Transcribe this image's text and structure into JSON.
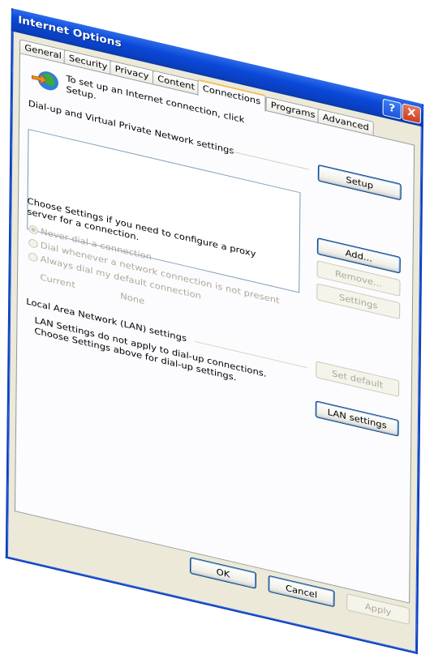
{
  "window": {
    "title": "Internet Options",
    "help_glyph": "?",
    "close_glyph": "X"
  },
  "tabs": [
    {
      "label": "General"
    },
    {
      "label": "Security"
    },
    {
      "label": "Privacy"
    },
    {
      "label": "Content"
    },
    {
      "label": "Connections",
      "active": true
    },
    {
      "label": "Programs"
    },
    {
      "label": "Advanced"
    }
  ],
  "setup": {
    "text_line1": "To set up an Internet connection, click",
    "text_line2": "Setup.",
    "button": "Setup"
  },
  "dialup": {
    "heading": "Dial-up and Virtual Private Network settings",
    "add_button": "Add...",
    "remove_button": "Remove...",
    "settings_button": "Settings",
    "proxy_text_line1": "Choose Settings if you need to configure a proxy",
    "proxy_text_line2": "server for a connection.",
    "options": [
      {
        "label": "Never dial a connection",
        "checked": true
      },
      {
        "label": "Dial whenever a network connection is not present",
        "checked": false
      },
      {
        "label": "Always dial my default connection",
        "checked": false
      }
    ],
    "current_label": "Current",
    "current_value": "None",
    "set_default_button": "Set default"
  },
  "lan": {
    "heading": "Local Area Network (LAN) settings",
    "text_line1": "LAN Settings do not apply to dial-up connections.",
    "text_line2": "Choose Settings above for dial-up settings.",
    "button": "LAN settings"
  },
  "footer": {
    "ok": "OK",
    "cancel": "Cancel",
    "apply": "Apply"
  },
  "colors": {
    "titlebar": "#0a49d8",
    "dialog_bg": "#ece9d8",
    "active_tab_accent": "#f7b94a",
    "disabled_text": "#aca899"
  },
  "icons": {
    "connection_wizard": "globe-connect-icon"
  }
}
